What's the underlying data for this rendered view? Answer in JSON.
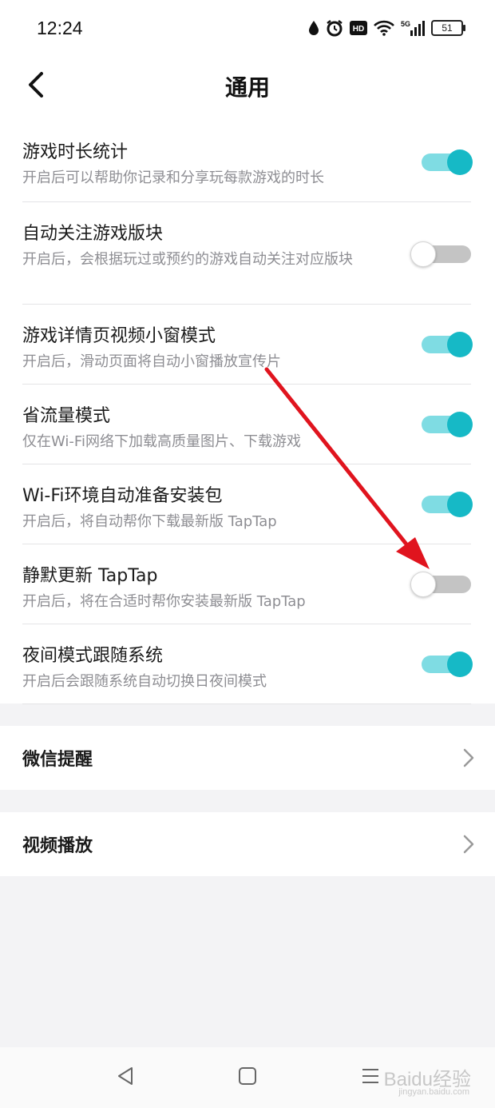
{
  "status_bar": {
    "time": "12:24",
    "icons": [
      "drop-icon",
      "alarm-icon",
      "hd-icon",
      "wifi-icon",
      "5g-signal-icon"
    ],
    "hd_label": "HD",
    "network_label": "5G",
    "battery": "51"
  },
  "header": {
    "title": "通用"
  },
  "settings": [
    {
      "title": "游戏时长统计",
      "desc": "开启后可以帮助你记录和分享玩每款游戏的时长",
      "on": true
    },
    {
      "title": "自动关注游戏版块",
      "desc": "开启后，会根据玩过或预约的游戏自动关注对应版块",
      "on": false
    },
    {
      "title": "游戏详情页视频小窗模式",
      "desc": "开启后，滑动页面将自动小窗播放宣传片",
      "on": true
    },
    {
      "title": "省流量模式",
      "desc": "仅在Wi-Fi网络下加载高质量图片、下载游戏",
      "on": true
    },
    {
      "title": "Wi-Fi环境自动准备安装包",
      "desc": "开启后，将自动帮你下载最新版 TapTap",
      "on": true
    },
    {
      "title": "静默更新 TapTap",
      "desc": "开启后，将在合适时帮你安装最新版 TapTap",
      "on": false
    },
    {
      "title": "夜间模式跟随系统",
      "desc": "开启后会跟随系统自动切换日夜间模式",
      "on": true
    }
  ],
  "nav_items": [
    {
      "label": "微信提醒"
    },
    {
      "label": "视频播放"
    }
  ],
  "colors": {
    "toggle_on_track": "#7fdce3",
    "toggle_on_knob": "#16b9c6",
    "toggle_off_track": "#c4c4c4",
    "annotation_arrow": "#e0141e"
  },
  "watermark": {
    "brand": "Baidu经验",
    "url": "jingyan.baidu.com"
  }
}
